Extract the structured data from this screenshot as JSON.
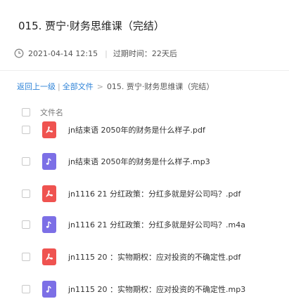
{
  "page": {
    "title": "015. 贾宁·财务思维课（完结）",
    "date": "2021-04-14 12:15",
    "expiry": "过期时间：22天后"
  },
  "breadcrumb": {
    "back": "返回上一级",
    "all_files": "全部文件",
    "current": "015. 贾宁·财务思维课（完结）"
  },
  "table": {
    "column_name": "文件名",
    "files": [
      {
        "name": "jn结束语 2050年的财务是什么样子.pdf",
        "type": "pdf"
      },
      {
        "name": "jn结束语 2050年的财务是什么样子.mp3",
        "type": "audio"
      },
      {
        "name": "jn1116 21 分红政策：分红多就是好公司吗？.pdf",
        "type": "pdf"
      },
      {
        "name": "jn1116 21 分红政策：分红多就是好公司吗？.m4a",
        "type": "audio"
      },
      {
        "name": "jn1115 20 ：实物期权：应对投资的不确定性.pdf",
        "type": "pdf"
      },
      {
        "name": "jn1115 20 ：实物期权：应对投资的不确定性.mp3",
        "type": "audio"
      }
    ]
  },
  "colors": {
    "link": "#2e83d8",
    "pdf": "#ef5350",
    "audio": "#7c6fe6"
  },
  "icons": [
    "clock-icon",
    "pdf-file-icon",
    "music-file-icon"
  ]
}
